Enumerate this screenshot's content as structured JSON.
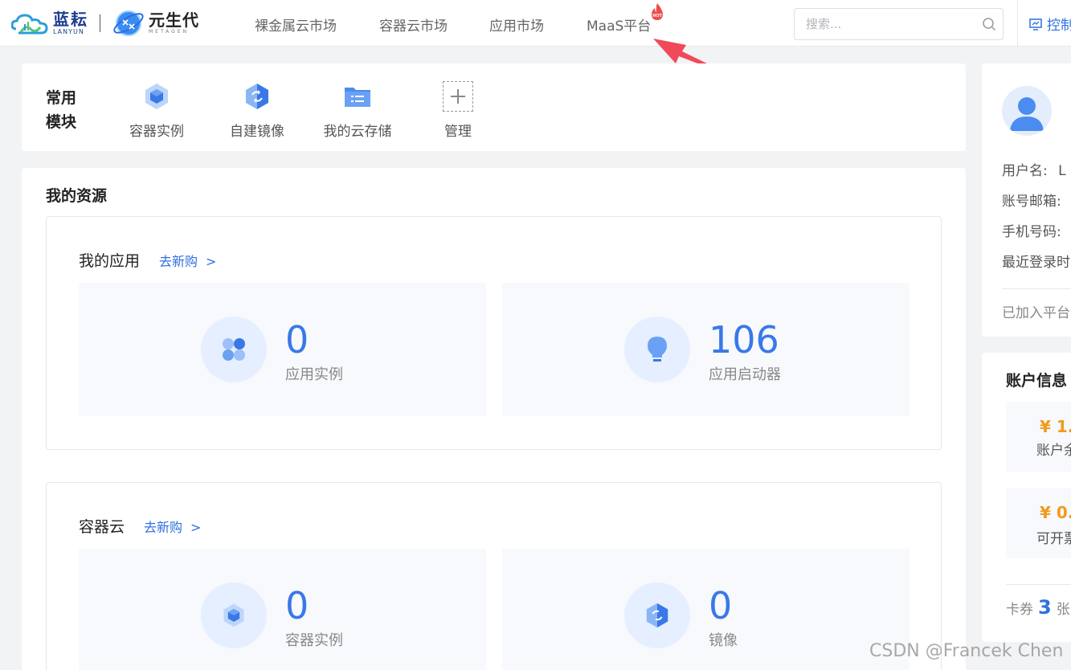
{
  "brand": {
    "lanyun_cn": "蓝耘",
    "lanyun_en": "LANYUN",
    "metagen_cn": "元生代",
    "metagen_en": "METAGEN"
  },
  "nav": {
    "items": [
      {
        "label": "裸金属云市场"
      },
      {
        "label": "容器云市场"
      },
      {
        "label": "应用市场"
      },
      {
        "label": "MaaS平台",
        "badge": "HOT"
      }
    ],
    "search_placeholder": "搜索...",
    "console_label": "控制"
  },
  "common_modules": {
    "title": "常用模块",
    "items": [
      {
        "label": "容器实例",
        "icon": "cube-icon"
      },
      {
        "label": "自建镜像",
        "icon": "image-icon"
      },
      {
        "label": "我的云存储",
        "icon": "folder-icon"
      },
      {
        "label": "管理",
        "icon": "plus-icon"
      }
    ]
  },
  "resources": {
    "title": "我的资源",
    "apps": {
      "title": "我的应用",
      "buy_label": "去新购",
      "buy_chevron": ">",
      "stats": [
        {
          "value": "0",
          "label": "应用实例",
          "icon": "apps-grid-icon"
        },
        {
          "value": "106",
          "label": "应用启动器",
          "icon": "lightbulb-icon"
        }
      ]
    },
    "containers": {
      "title": "容器云",
      "buy_label": "去新购",
      "buy_chevron": ">",
      "stats": [
        {
          "value": "0",
          "label": "容器实例",
          "icon": "cube-icon"
        },
        {
          "value": "0",
          "label": "镜像",
          "icon": "image-icon"
        }
      ]
    }
  },
  "user": {
    "username_label": "用户名:",
    "username_value": "L",
    "email_label": "账号邮箱:",
    "phone_label": "手机号码:",
    "last_login_label": "最近登录时",
    "joined_label": "已加入平台"
  },
  "account": {
    "title": "账户信息",
    "balances": [
      {
        "amount": "¥ 1.",
        "label": "账户余"
      },
      {
        "amount": "¥ 0.",
        "label": "可开票"
      }
    ],
    "coupon_label": "卡券",
    "coupon_count": "3",
    "coupon_unit": "张"
  },
  "watermark": "CSDN @Francek Chen",
  "colors": {
    "accent": "#2f6fe0",
    "number_blue": "#3a78e8",
    "money_orange": "#f29a1c",
    "arrow_red": "#f04a5a"
  }
}
